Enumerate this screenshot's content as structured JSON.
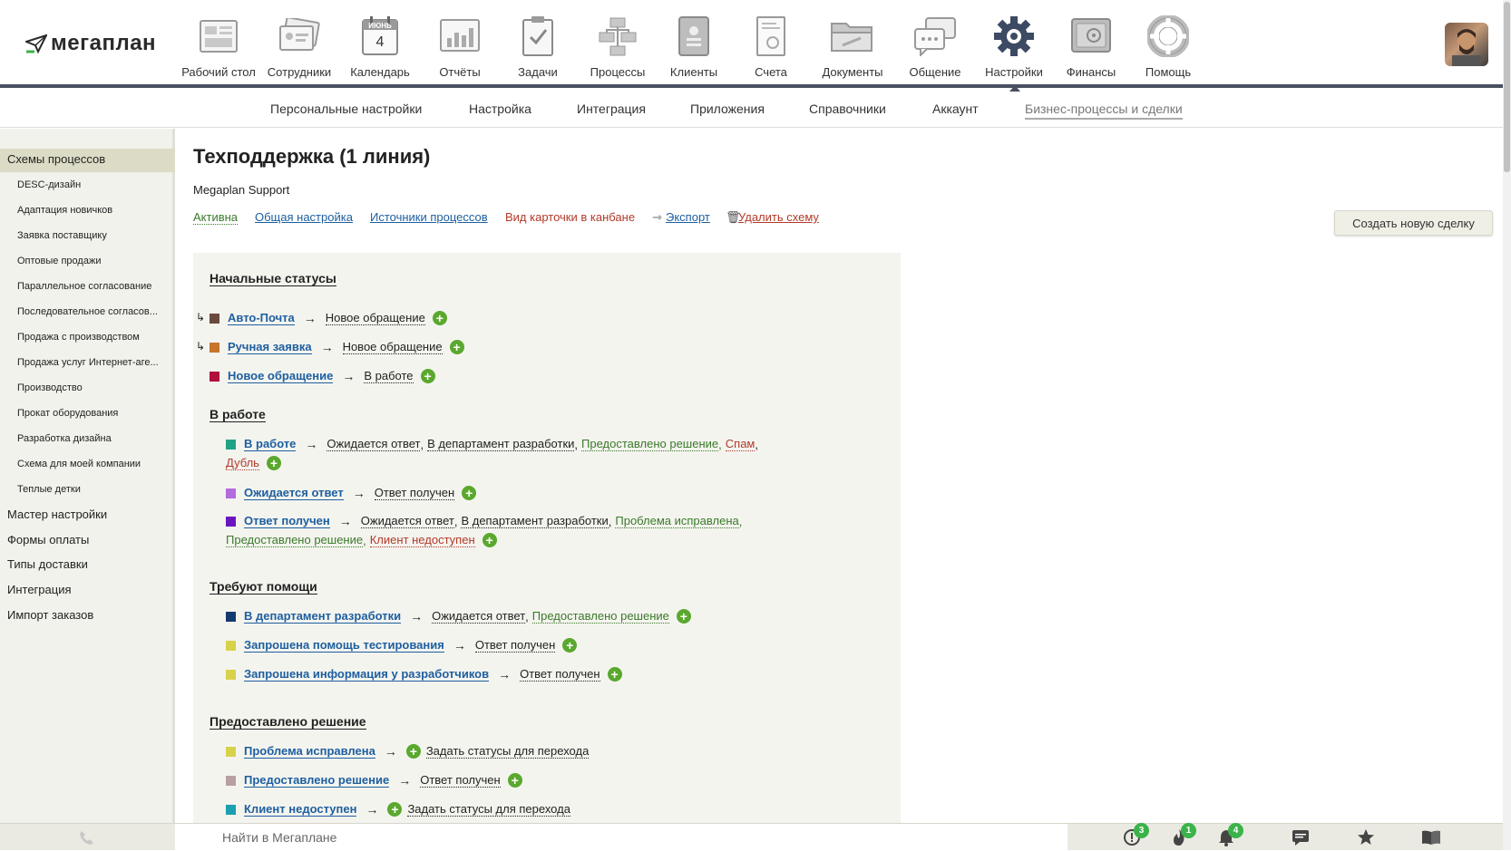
{
  "app": {
    "logo": "мегаплан"
  },
  "modules": [
    {
      "label": "Рабочий стол",
      "icon": "desktop-icon"
    },
    {
      "label": "Сотрудники",
      "icon": "employees-icon"
    },
    {
      "label": "Календарь",
      "icon": "calendar-icon",
      "month": "ИЮНЬ",
      "day": "4"
    },
    {
      "label": "Отчёты",
      "icon": "reports-icon"
    },
    {
      "label": "Задачи",
      "icon": "tasks-icon"
    },
    {
      "label": "Процессы",
      "icon": "processes-icon"
    },
    {
      "label": "Клиенты",
      "icon": "clients-icon"
    },
    {
      "label": "Счета",
      "icon": "invoices-icon"
    },
    {
      "label": "Документы",
      "icon": "documents-icon"
    },
    {
      "label": "Общение",
      "icon": "communication-icon"
    },
    {
      "label": "Настройки",
      "icon": "settings-gear-icon",
      "active": true
    },
    {
      "label": "Финансы",
      "icon": "finance-safe-icon"
    },
    {
      "label": "Помощь",
      "icon": "help-lifebuoy-icon"
    }
  ],
  "subnav": [
    "Персональные настройки",
    "Настройка",
    "Интеграция",
    "Приложения",
    "Справочники",
    "Аккаунт",
    "Бизнес-процессы и сделки"
  ],
  "sidebar": {
    "top": "Схемы процессов",
    "sub": [
      "DESC-дизайн",
      "Адаптация новичков",
      "Заявка поставщику",
      "Оптовые продажи",
      "Параллельное согласование",
      "Последовательное согласов...",
      "Продажа с производством",
      "Продажа услуг Интернет-аге...",
      "Производство",
      "Прокат оборудования",
      "Разработка дизайна",
      "Схема для моей компании",
      "Теплые детки"
    ],
    "items": [
      "Мастер настройки",
      "Формы оплаты",
      "Типы доставки",
      "Интеграция",
      "Импорт заказов"
    ]
  },
  "main": {
    "title": "Техподдержка (1 линия)",
    "subtitle": "Megaplan Support",
    "links": {
      "active": "Активна",
      "general": "Общая настройка",
      "sources": "Источники процессов",
      "kanban": "Вид карточки в канбане",
      "export": "Экспорт",
      "delete": "Удалить схему"
    },
    "create_button": "Создать новую сделку"
  },
  "sections": {
    "initial": "Начальные статусы",
    "inwork": "В работе",
    "help": "Требуют помощи",
    "solved": "Предоставлено решение"
  },
  "rows": {
    "r1": {
      "status": "Авто-Почта",
      "t": [
        "Новое обращение"
      ],
      "color": "#6b4a3e"
    },
    "r2": {
      "status": "Ручная заявка",
      "t": [
        "Новое обращение"
      ],
      "color": "#c9742b"
    },
    "r3": {
      "status": "Новое обращение",
      "t": [
        "В работе"
      ],
      "color": "#b0103a"
    },
    "r4": {
      "status": "В работе",
      "t": [
        "Ожидается ответ",
        "В департамент разработки",
        "Предоставлено решение",
        "Спам",
        "Дубль"
      ],
      "color": "#1fa384"
    },
    "r5": {
      "status": "Ожидается ответ",
      "t": [
        "Ответ получен"
      ],
      "color": "#b36be0"
    },
    "r6": {
      "status": "Ответ получен",
      "t": [
        "Ожидается ответ",
        "В департамент разработки",
        "Проблема исправлена",
        "Предоставлено решение",
        "Клиент недоступен"
      ],
      "color": "#6a16c0"
    },
    "r7": {
      "status": "В департамент разработки",
      "t": [
        "Ожидается ответ",
        "Предоставлено решение"
      ],
      "color": "#123a6e"
    },
    "r8": {
      "status": "Запрошена помощь тестирования",
      "t": [
        "Ответ получен"
      ],
      "color": "#d8d24a"
    },
    "r9": {
      "status": "Запрошена информация у разработчиков",
      "t": [
        "Ответ получен"
      ],
      "color": "#d8d24a"
    },
    "r10": {
      "status": "Проблема исправлена",
      "t": [
        "Задать статусы для перехода"
      ],
      "color": "#d8d24a"
    },
    "r11": {
      "status": "Предоставлено решение",
      "t": [
        "Ответ получен"
      ],
      "color": "#b8a0a0"
    },
    "r12": {
      "status": "Клиент недоступен",
      "t": [
        "Задать статусы для перехода"
      ],
      "color": "#1aa0b0"
    }
  },
  "bottom": {
    "search_placeholder": "Найти в Мегаплане",
    "badges": {
      "alerts": "3",
      "hot": "1",
      "bell": "4"
    }
  }
}
